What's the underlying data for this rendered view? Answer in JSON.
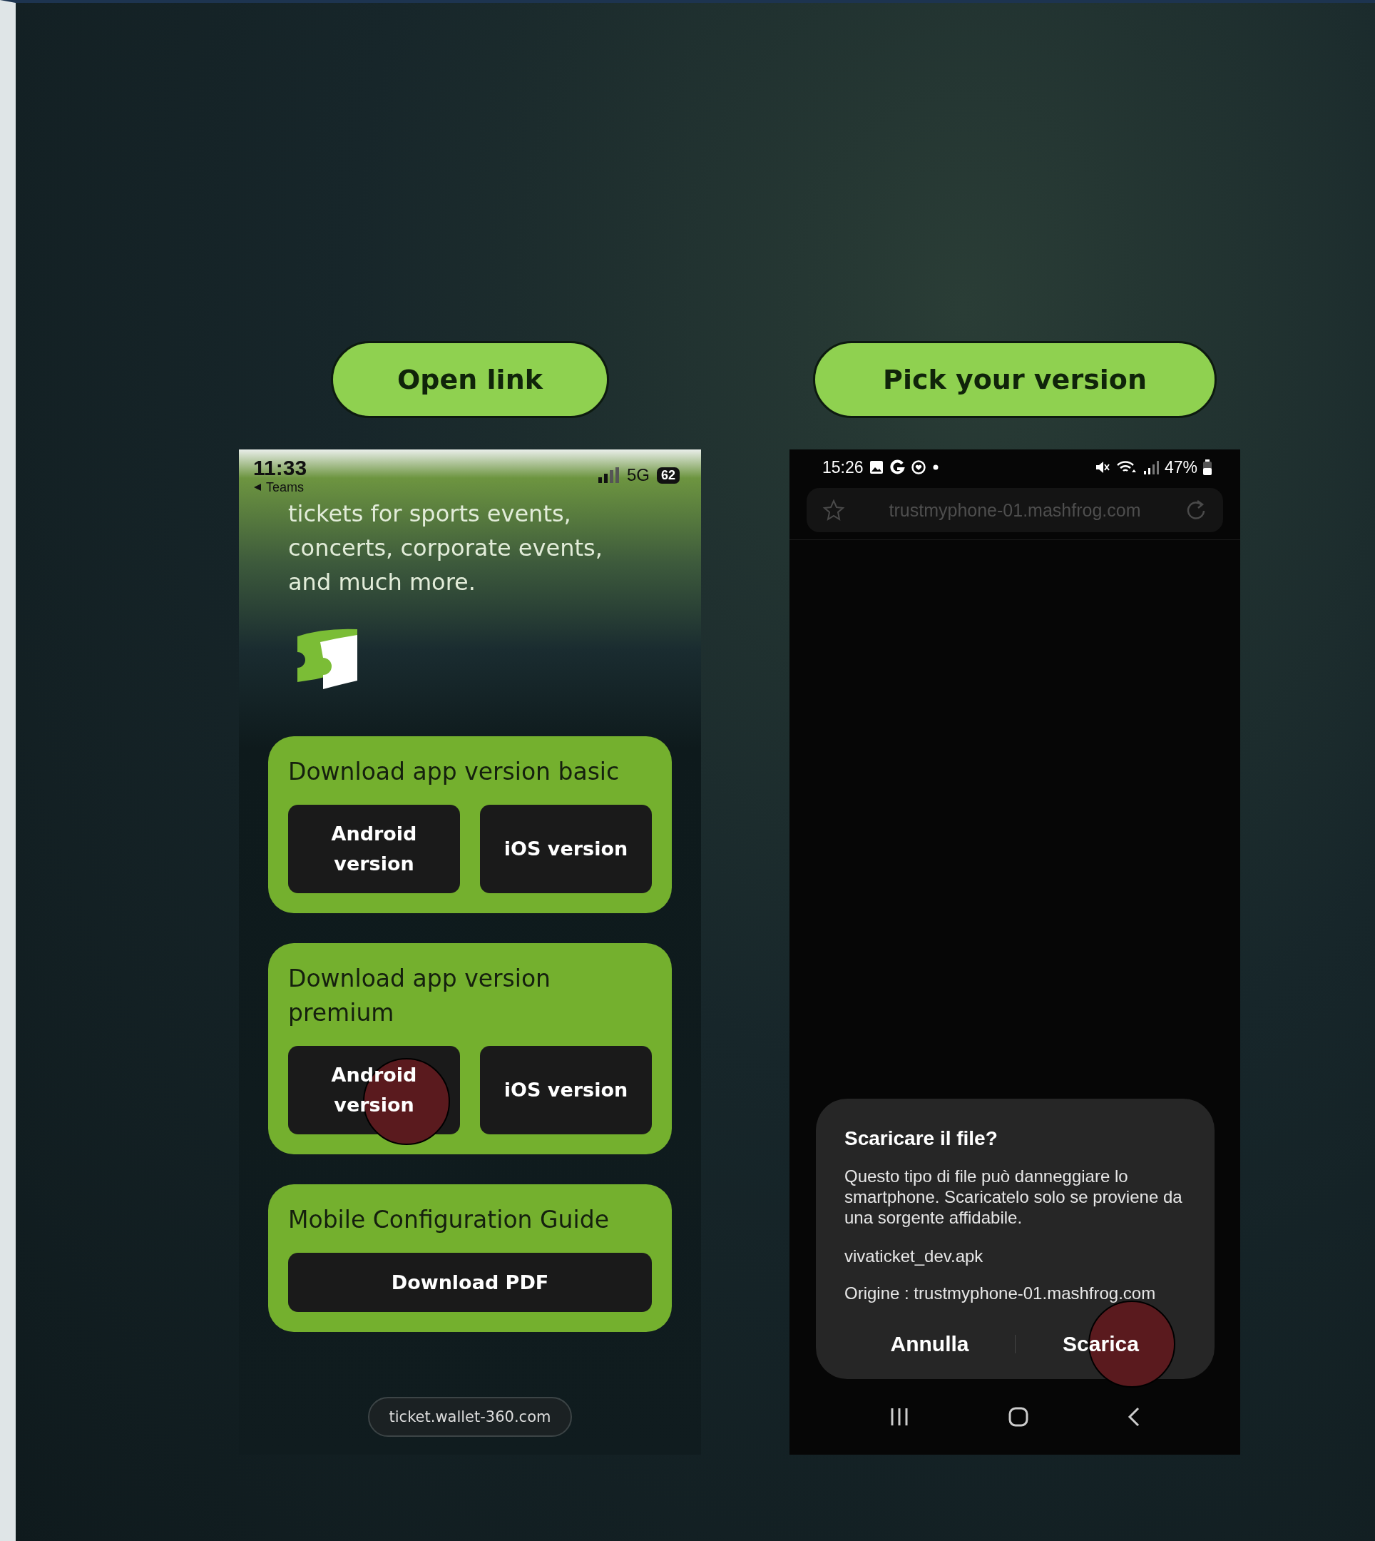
{
  "steps": [
    {
      "label": "Open link"
    },
    {
      "label": "Pick your version"
    }
  ],
  "left_phone": {
    "status_bar": {
      "time": "11:33",
      "back_label": "Teams",
      "network": "5G",
      "battery": "62"
    },
    "tagline": "tickets for sports events, concerts, corporate events, and much more.",
    "cards": [
      {
        "title": "Download app version basic",
        "buttons": [
          {
            "label": "Android version",
            "tapped": false
          },
          {
            "label": "iOS version",
            "tapped": false
          }
        ]
      },
      {
        "title": "Download app version premium",
        "buttons": [
          {
            "label": "Android version",
            "tapped": true
          },
          {
            "label": "iOS version",
            "tapped": false
          }
        ]
      },
      {
        "title": "Mobile Configuration Guide",
        "buttons": [
          {
            "label": "Download PDF",
            "tapped": false
          }
        ]
      }
    ],
    "url": "ticket.wallet-360.com"
  },
  "right_phone": {
    "status_bar": {
      "time": "15:26",
      "battery": "47%"
    },
    "address": "trustmyphone-01.mashfrog.com",
    "dialog": {
      "title": "Scaricare il file?",
      "message": "Questo tipo di file può danneggiare lo smartphone. Scaricatelo solo se proviene da una sorgente affidabile.",
      "filename": "vivaticket_dev.apk",
      "origin": "Origine : trustmyphone-01.mashfrog.com",
      "actions": [
        {
          "label": "Annulla",
          "tapped": false
        },
        {
          "label": "Scarica",
          "tapped": true
        }
      ]
    }
  }
}
